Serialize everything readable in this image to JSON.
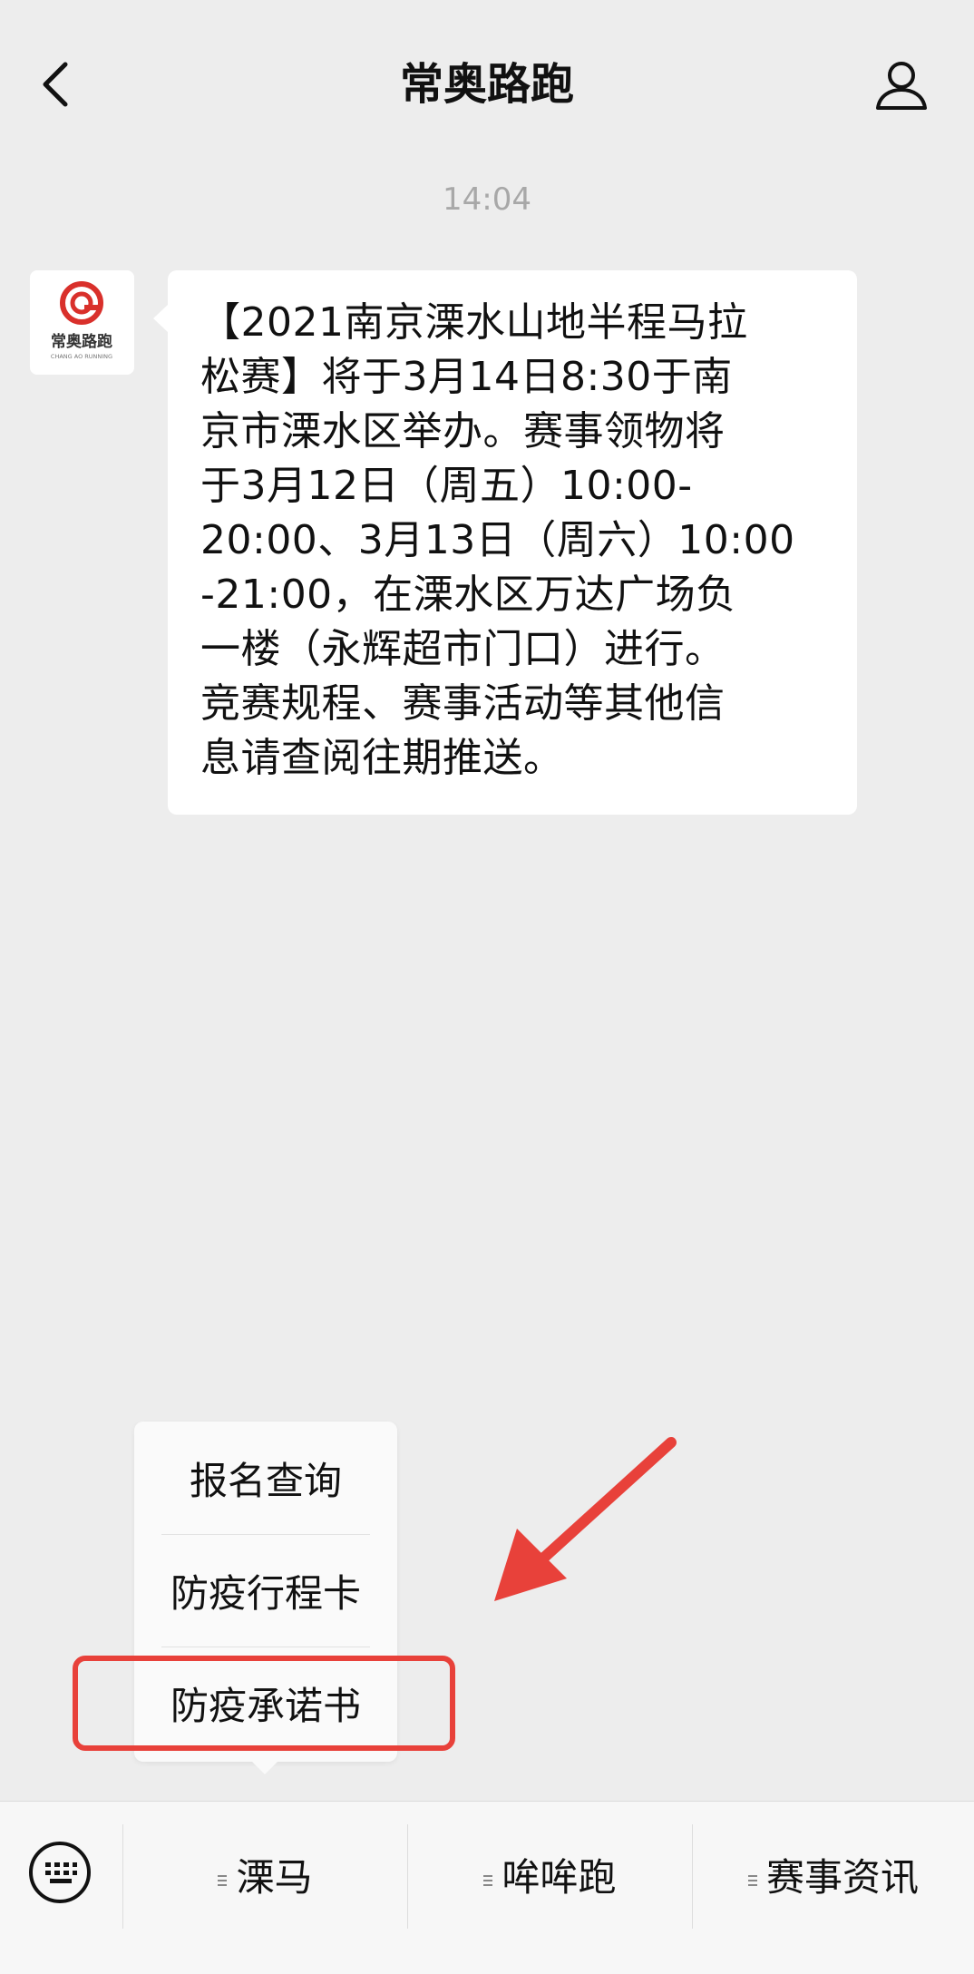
{
  "header": {
    "title": "常奥路跑",
    "back_icon": "chevron-left-icon",
    "profile_icon": "person-icon"
  },
  "chat": {
    "timestamp": "14:04",
    "message": {
      "avatar_label": "常奥路跑",
      "avatar_sublabel": "CHANG AO RUNNING",
      "lines": [
        "【2021南京溧水山地半程马拉",
        "松赛】将于3月14日8:30于南",
        "京市溧水区举办。赛事领物将",
        "于3月12日（周五）10:00-",
        "20:00、3月13日（周六）10:00",
        "-21:00，在溧水区万达广场负",
        "一楼（永辉超市门口）进行。",
        "竞赛规程、赛事活动等其他信",
        "息请查阅往期推送。"
      ]
    }
  },
  "popup_menu": {
    "items": [
      "报名查询",
      "防疫行程卡",
      "防疫承诺书"
    ]
  },
  "bottom_menu": {
    "keyboard_icon": "keyboard-icon",
    "items": [
      "溧马",
      "哞哞跑",
      "赛事资讯"
    ]
  },
  "colors": {
    "background": "#ededed",
    "highlight": "#e8413a",
    "logo_red": "#d9302b"
  }
}
